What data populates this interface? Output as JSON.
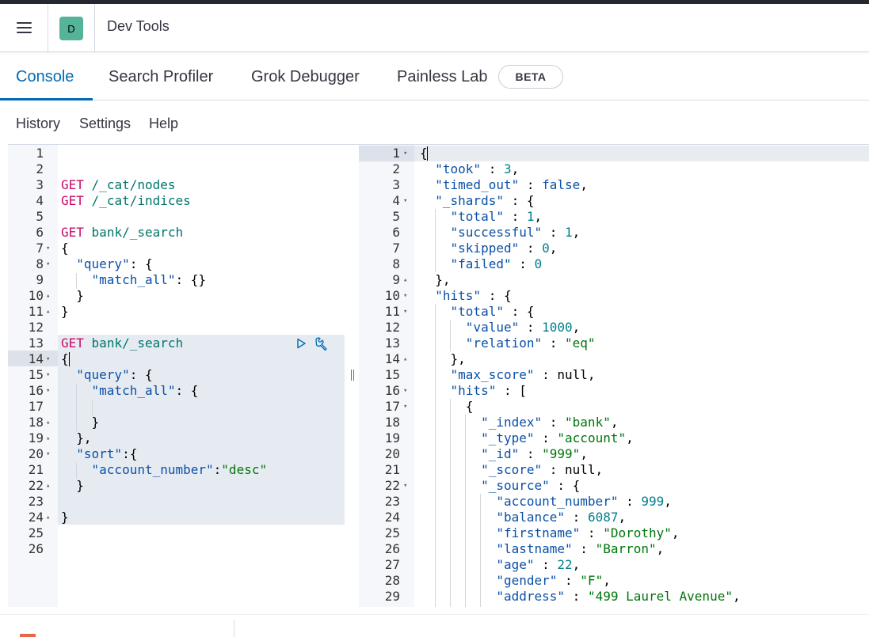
{
  "header": {
    "menu_icon": "hamburger-menu-icon",
    "space_initial": "D",
    "space_color": "#54b399",
    "title": "Dev Tools"
  },
  "tabs": [
    {
      "label": "Console",
      "active": true
    },
    {
      "label": "Search Profiler",
      "active": false
    },
    {
      "label": "Grok Debugger",
      "active": false
    },
    {
      "label": "Painless Lab",
      "active": false
    }
  ],
  "beta_badge": "BETA",
  "subnav": {
    "history": "History",
    "settings": "Settings",
    "help": "Help"
  },
  "colors": {
    "accent": "#006bb4",
    "method": "#c80a68",
    "url": "#00756c",
    "key": "#0b50a6",
    "string": "#00750b",
    "number": "#007f8a"
  },
  "request_editor": {
    "lines": [
      {
        "n": "1",
        "fold": "",
        "tokens": []
      },
      {
        "n": "2",
        "fold": "",
        "tokens": []
      },
      {
        "n": "3",
        "fold": "",
        "tokens": [
          [
            "method",
            "GET"
          ],
          [
            "punc",
            " "
          ],
          [
            "url",
            "/_cat/nodes"
          ]
        ]
      },
      {
        "n": "4",
        "fold": "",
        "tokens": [
          [
            "method",
            "GET"
          ],
          [
            "punc",
            " "
          ],
          [
            "url",
            "/_cat/indices"
          ]
        ]
      },
      {
        "n": "5",
        "fold": "",
        "tokens": []
      },
      {
        "n": "6",
        "fold": "",
        "tokens": [
          [
            "method",
            "GET"
          ],
          [
            "punc",
            " "
          ],
          [
            "url",
            "bank/_search"
          ]
        ]
      },
      {
        "n": "7",
        "fold": "▾",
        "tokens": [
          [
            "punc",
            "{"
          ]
        ]
      },
      {
        "n": "8",
        "fold": "▾",
        "tokens": [
          [
            "punc",
            "  "
          ],
          [
            "key",
            "\"query\""
          ],
          [
            "punc",
            ": {"
          ]
        ]
      },
      {
        "n": "9",
        "fold": "",
        "tokens": [
          [
            "punc",
            "    "
          ],
          [
            "key",
            "\"match_all\""
          ],
          [
            "punc",
            ": {}"
          ]
        ]
      },
      {
        "n": "10",
        "fold": "▴",
        "tokens": [
          [
            "punc",
            "  }"
          ]
        ]
      },
      {
        "n": "11",
        "fold": "▴",
        "tokens": [
          [
            "punc",
            "}"
          ]
        ]
      },
      {
        "n": "12",
        "fold": "",
        "tokens": []
      },
      {
        "n": "13",
        "fold": "",
        "tokens": [
          [
            "method",
            "GET"
          ],
          [
            "punc",
            " "
          ],
          [
            "url",
            "bank/_search"
          ]
        ]
      },
      {
        "n": "14",
        "fold": "▾",
        "tokens": [
          [
            "punc",
            "{"
          ]
        ]
      },
      {
        "n": "15",
        "fold": "▾",
        "tokens": [
          [
            "punc",
            "  "
          ],
          [
            "key",
            "\"query\""
          ],
          [
            "punc",
            ": {"
          ]
        ]
      },
      {
        "n": "16",
        "fold": "▾",
        "tokens": [
          [
            "punc",
            "    "
          ],
          [
            "key",
            "\"match_all\""
          ],
          [
            "punc",
            ": {"
          ]
        ]
      },
      {
        "n": "17",
        "fold": "",
        "tokens": []
      },
      {
        "n": "18",
        "fold": "▴",
        "tokens": [
          [
            "punc",
            "    }"
          ]
        ]
      },
      {
        "n": "19",
        "fold": "▴",
        "tokens": [
          [
            "punc",
            "  },"
          ]
        ]
      },
      {
        "n": "20",
        "fold": "▾",
        "tokens": [
          [
            "punc",
            "  "
          ],
          [
            "key",
            "\"sort\""
          ],
          [
            "punc",
            ":{"
          ]
        ]
      },
      {
        "n": "21",
        "fold": "",
        "tokens": [
          [
            "punc",
            "    "
          ],
          [
            "key",
            "\"account_number\""
          ],
          [
            "punc",
            ":"
          ],
          [
            "str",
            "\"desc\""
          ]
        ]
      },
      {
        "n": "22",
        "fold": "▴",
        "tokens": [
          [
            "punc",
            "  }"
          ]
        ]
      },
      {
        "n": "23",
        "fold": "",
        "tokens": []
      },
      {
        "n": "24",
        "fold": "▴",
        "tokens": [
          [
            "punc",
            "}"
          ]
        ]
      },
      {
        "n": "25",
        "fold": "",
        "tokens": []
      },
      {
        "n": "26",
        "fold": "",
        "tokens": []
      }
    ],
    "actions": {
      "send_icon": "play-icon",
      "settings_icon": "wrench-icon"
    }
  },
  "response_editor": {
    "lines": [
      {
        "n": "1",
        "fold": "▾",
        "tokens": [
          [
            "punc",
            "{"
          ]
        ]
      },
      {
        "n": "2",
        "fold": "",
        "tokens": [
          [
            "punc",
            "  "
          ],
          [
            "key",
            "\"took\""
          ],
          [
            "punc",
            " : "
          ],
          [
            "num",
            "3"
          ],
          [
            "punc",
            ","
          ]
        ]
      },
      {
        "n": "3",
        "fold": "",
        "tokens": [
          [
            "punc",
            "  "
          ],
          [
            "key",
            "\"timed_out\""
          ],
          [
            "punc",
            " : "
          ],
          [
            "bool",
            "false"
          ],
          [
            "punc",
            ","
          ]
        ]
      },
      {
        "n": "4",
        "fold": "▾",
        "tokens": [
          [
            "punc",
            "  "
          ],
          [
            "key",
            "\"_shards\""
          ],
          [
            "punc",
            " : {"
          ]
        ]
      },
      {
        "n": "5",
        "fold": "",
        "tokens": [
          [
            "punc",
            "    "
          ],
          [
            "key",
            "\"total\""
          ],
          [
            "punc",
            " : "
          ],
          [
            "num",
            "1"
          ],
          [
            "punc",
            ","
          ]
        ]
      },
      {
        "n": "6",
        "fold": "",
        "tokens": [
          [
            "punc",
            "    "
          ],
          [
            "key",
            "\"successful\""
          ],
          [
            "punc",
            " : "
          ],
          [
            "num",
            "1"
          ],
          [
            "punc",
            ","
          ]
        ]
      },
      {
        "n": "7",
        "fold": "",
        "tokens": [
          [
            "punc",
            "    "
          ],
          [
            "key",
            "\"skipped\""
          ],
          [
            "punc",
            " : "
          ],
          [
            "num",
            "0"
          ],
          [
            "punc",
            ","
          ]
        ]
      },
      {
        "n": "8",
        "fold": "",
        "tokens": [
          [
            "punc",
            "    "
          ],
          [
            "key",
            "\"failed\""
          ],
          [
            "punc",
            " : "
          ],
          [
            "num",
            "0"
          ]
        ]
      },
      {
        "n": "9",
        "fold": "▴",
        "tokens": [
          [
            "punc",
            "  },"
          ]
        ]
      },
      {
        "n": "10",
        "fold": "▾",
        "tokens": [
          [
            "punc",
            "  "
          ],
          [
            "key",
            "\"hits\""
          ],
          [
            "punc",
            " : {"
          ]
        ]
      },
      {
        "n": "11",
        "fold": "▾",
        "tokens": [
          [
            "punc",
            "    "
          ],
          [
            "key",
            "\"total\""
          ],
          [
            "punc",
            " : {"
          ]
        ]
      },
      {
        "n": "12",
        "fold": "",
        "tokens": [
          [
            "punc",
            "      "
          ],
          [
            "key",
            "\"value\""
          ],
          [
            "punc",
            " : "
          ],
          [
            "num",
            "1000"
          ],
          [
            "punc",
            ","
          ]
        ]
      },
      {
        "n": "13",
        "fold": "",
        "tokens": [
          [
            "punc",
            "      "
          ],
          [
            "key",
            "\"relation\""
          ],
          [
            "punc",
            " : "
          ],
          [
            "str",
            "\"eq\""
          ]
        ]
      },
      {
        "n": "14",
        "fold": "▴",
        "tokens": [
          [
            "punc",
            "    },"
          ]
        ]
      },
      {
        "n": "15",
        "fold": "",
        "tokens": [
          [
            "punc",
            "    "
          ],
          [
            "key",
            "\"max_score\""
          ],
          [
            "punc",
            " : null,"
          ]
        ]
      },
      {
        "n": "16",
        "fold": "▾",
        "tokens": [
          [
            "punc",
            "    "
          ],
          [
            "key",
            "\"hits\""
          ],
          [
            "punc",
            " : ["
          ]
        ]
      },
      {
        "n": "17",
        "fold": "▾",
        "tokens": [
          [
            "punc",
            "      {"
          ]
        ]
      },
      {
        "n": "18",
        "fold": "",
        "tokens": [
          [
            "punc",
            "        "
          ],
          [
            "key",
            "\"_index\""
          ],
          [
            "punc",
            " : "
          ],
          [
            "str",
            "\"bank\""
          ],
          [
            "punc",
            ","
          ]
        ]
      },
      {
        "n": "19",
        "fold": "",
        "tokens": [
          [
            "punc",
            "        "
          ],
          [
            "key",
            "\"_type\""
          ],
          [
            "punc",
            " : "
          ],
          [
            "str",
            "\"account\""
          ],
          [
            "punc",
            ","
          ]
        ]
      },
      {
        "n": "20",
        "fold": "",
        "tokens": [
          [
            "punc",
            "        "
          ],
          [
            "key",
            "\"_id\""
          ],
          [
            "punc",
            " : "
          ],
          [
            "str",
            "\"999\""
          ],
          [
            "punc",
            ","
          ]
        ]
      },
      {
        "n": "21",
        "fold": "",
        "tokens": [
          [
            "punc",
            "        "
          ],
          [
            "key",
            "\"_score\""
          ],
          [
            "punc",
            " : null,"
          ]
        ]
      },
      {
        "n": "22",
        "fold": "▾",
        "tokens": [
          [
            "punc",
            "        "
          ],
          [
            "key",
            "\"_source\""
          ],
          [
            "punc",
            " : {"
          ]
        ]
      },
      {
        "n": "23",
        "fold": "",
        "tokens": [
          [
            "punc",
            "          "
          ],
          [
            "key",
            "\"account_number\""
          ],
          [
            "punc",
            " : "
          ],
          [
            "num",
            "999"
          ],
          [
            "punc",
            ","
          ]
        ]
      },
      {
        "n": "24",
        "fold": "",
        "tokens": [
          [
            "punc",
            "          "
          ],
          [
            "key",
            "\"balance\""
          ],
          [
            "punc",
            " : "
          ],
          [
            "num",
            "6087"
          ],
          [
            "punc",
            ","
          ]
        ]
      },
      {
        "n": "25",
        "fold": "",
        "tokens": [
          [
            "punc",
            "          "
          ],
          [
            "key",
            "\"firstname\""
          ],
          [
            "punc",
            " : "
          ],
          [
            "str",
            "\"Dorothy\""
          ],
          [
            "punc",
            ","
          ]
        ]
      },
      {
        "n": "26",
        "fold": "",
        "tokens": [
          [
            "punc",
            "          "
          ],
          [
            "key",
            "\"lastname\""
          ],
          [
            "punc",
            " : "
          ],
          [
            "str",
            "\"Barron\""
          ],
          [
            "punc",
            ","
          ]
        ]
      },
      {
        "n": "27",
        "fold": "",
        "tokens": [
          [
            "punc",
            "          "
          ],
          [
            "key",
            "\"age\""
          ],
          [
            "punc",
            " : "
          ],
          [
            "num",
            "22"
          ],
          [
            "punc",
            ","
          ]
        ]
      },
      {
        "n": "28",
        "fold": "",
        "tokens": [
          [
            "punc",
            "          "
          ],
          [
            "key",
            "\"gender\""
          ],
          [
            "punc",
            " : "
          ],
          [
            "str",
            "\"F\""
          ],
          [
            "punc",
            ","
          ]
        ]
      },
      {
        "n": "29",
        "fold": "",
        "tokens": [
          [
            "punc",
            "          "
          ],
          [
            "key",
            "\"address\""
          ],
          [
            "punc",
            " : "
          ],
          [
            "str",
            "\"499 Laurel Avenue\""
          ],
          [
            "punc",
            ","
          ]
        ]
      }
    ]
  }
}
